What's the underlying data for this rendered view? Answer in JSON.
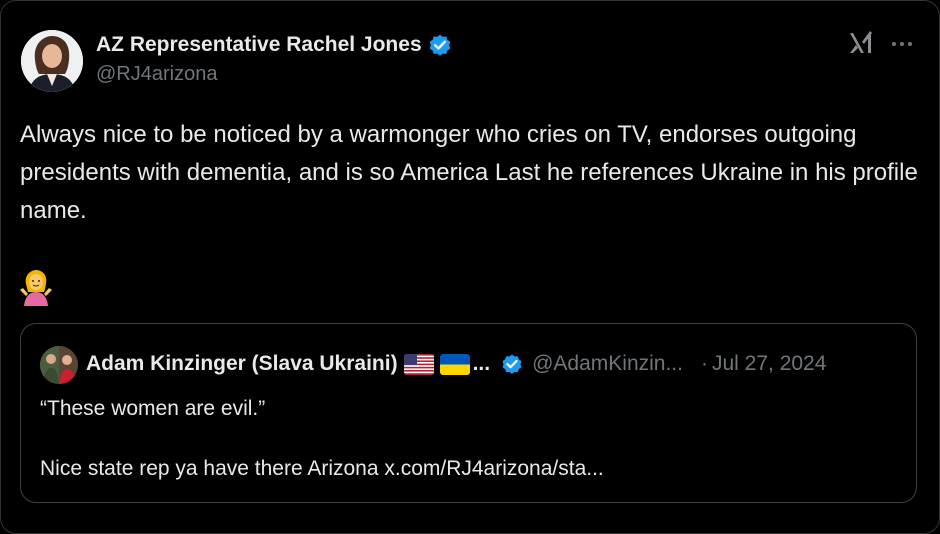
{
  "tweet": {
    "author_name": "AZ Representative Rachel Jones",
    "author_handle": "@RJ4arizona",
    "text": "Always nice to be noticed by a warmonger who cries on TV, endorses outgoing presidents with dementia, and is so America Last he references Ukraine in his profile name.",
    "emoji": "🤷‍♀️",
    "verified_color": "#1d9bf0"
  },
  "header_icons": {
    "platform": "xai-grok-icon",
    "more": "more-options-icon"
  },
  "quoted": {
    "author_name": "Adam Kinzinger (Slava Ukraini)",
    "name_suffix": "...",
    "flags": [
      "us-flag-icon",
      "ukraine-flag-icon"
    ],
    "author_handle": "@AdamKinzin...",
    "separator": "·",
    "date": "Jul 27, 2024",
    "text": "“These women are evil.”\n\nNice state rep ya have there Arizona x.com/RJ4arizona/sta..."
  }
}
